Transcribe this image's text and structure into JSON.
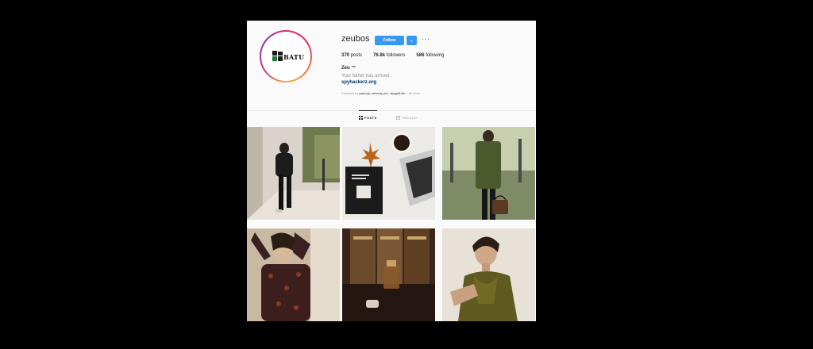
{
  "profile": {
    "username": "zeubos",
    "follow_label": "Follow",
    "dropdown_icon": "chevron-down-icon",
    "more_label": "···",
    "posts_count": "370",
    "posts_label": "posts",
    "followers_count": "76.8k",
    "followers_label": "followers",
    "following_count": "586",
    "following_label": "following",
    "full_name": "Zeu ™",
    "bio": "Your father has arrived.",
    "website": "spyhackerz.org",
    "followed_by_prefix": "Followed by",
    "followed_by_names": "pamraji, nehcha_per, nkyspfinds",
    "followed_by_suffix": "+ 38 more",
    "avatar_logo_text": "BATU"
  },
  "tabs": [
    {
      "label": "POSTS",
      "icon": "grid-icon",
      "active": true
    },
    {
      "label": "TAGGED",
      "icon": "tag-icon",
      "active": false
    }
  ],
  "colors": {
    "accent": "#3897f0",
    "background": "#fafafa",
    "page": "#000000"
  },
  "posts": [
    {
      "subject": "woman-walking-city-street"
    },
    {
      "subject": "flatlay-book-coffee-laptop-leaf"
    },
    {
      "subject": "woman-green-jacket-handbag"
    },
    {
      "subject": "woman-patterned-dress-dark"
    },
    {
      "subject": "perfume-bottle-books"
    },
    {
      "subject": "woman-olive-blouse"
    }
  ]
}
